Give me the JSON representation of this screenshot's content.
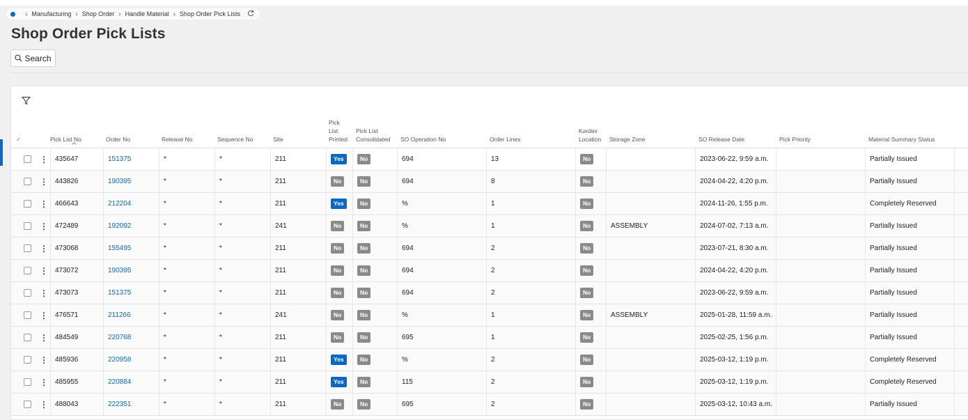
{
  "breadcrumb": {
    "items": [
      "Manufacturing",
      "Shop Order",
      "Handle Material",
      "Shop Order Pick Lists"
    ]
  },
  "page": {
    "title": "Shop Order Pick Lists",
    "search_label": "Search"
  },
  "table": {
    "columns": {
      "pick_list_no": "Pick List No",
      "order_no": "Order No",
      "release_no": "Release No",
      "sequence_no": "Sequence No",
      "site": "Site",
      "pick_list_printed_1": "Pick",
      "pick_list_printed_2": "List",
      "pick_list_printed_3": "Printed",
      "pick_list_consolidated_1": "Pick List",
      "pick_list_consolidated_2": "Consolidated",
      "so_operation_no": "SO Operation No",
      "order_lines": "Order Lines",
      "kardex_location_1": "Kardex",
      "kardex_location_2": "Location",
      "storage_zone": "Storage Zone",
      "so_release_date": "SO Release Date",
      "pick_priority": "Pick Priority",
      "material_summary_status": "Material Summary Status"
    },
    "rows": [
      {
        "pick_list_no": "435647",
        "order_no": "151375",
        "release_no": "*",
        "sequence_no": "*",
        "site": "211",
        "printed": "Yes",
        "consolidated": "No",
        "so_operation_no": "694",
        "order_lines": "13",
        "kardex": "No",
        "storage_zone": "",
        "so_release_date": "2023-06-22, 9:59 a.m.",
        "pick_priority": "",
        "status": "Partially Issued"
      },
      {
        "pick_list_no": "443826",
        "order_no": "190395",
        "release_no": "*",
        "sequence_no": "*",
        "site": "211",
        "printed": "No",
        "consolidated": "No",
        "so_operation_no": "694",
        "order_lines": "8",
        "kardex": "No",
        "storage_zone": "",
        "so_release_date": "2024-04-22, 4:20 p.m.",
        "pick_priority": "",
        "status": "Partially Issued"
      },
      {
        "pick_list_no": "466643",
        "order_no": "212204",
        "release_no": "*",
        "sequence_no": "*",
        "site": "211",
        "printed": "Yes",
        "consolidated": "No",
        "so_operation_no": "%",
        "order_lines": "1",
        "kardex": "No",
        "storage_zone": "",
        "so_release_date": "2024-11-26, 1:55 p.m.",
        "pick_priority": "",
        "status": "Completely Reserved"
      },
      {
        "pick_list_no": "472489",
        "order_no": "192092",
        "release_no": "*",
        "sequence_no": "*",
        "site": "241",
        "printed": "No",
        "consolidated": "No",
        "so_operation_no": "%",
        "order_lines": "1",
        "kardex": "No",
        "storage_zone": "ASSEMBLY",
        "so_release_date": "2024-07-02, 7:13 a.m.",
        "pick_priority": "",
        "status": "Partially Issued"
      },
      {
        "pick_list_no": "473068",
        "order_no": "155495",
        "release_no": "*",
        "sequence_no": "*",
        "site": "211",
        "printed": "No",
        "consolidated": "No",
        "so_operation_no": "694",
        "order_lines": "2",
        "kardex": "No",
        "storage_zone": "",
        "so_release_date": "2023-07-21, 8:30 a.m.",
        "pick_priority": "",
        "status": "Partially Issued"
      },
      {
        "pick_list_no": "473072",
        "order_no": "190395",
        "release_no": "*",
        "sequence_no": "*",
        "site": "211",
        "printed": "No",
        "consolidated": "No",
        "so_operation_no": "694",
        "order_lines": "2",
        "kardex": "No",
        "storage_zone": "",
        "so_release_date": "2024-04-22, 4:20 p.m.",
        "pick_priority": "",
        "status": "Partially Issued"
      },
      {
        "pick_list_no": "473073",
        "order_no": "151375",
        "release_no": "*",
        "sequence_no": "*",
        "site": "211",
        "printed": "No",
        "consolidated": "No",
        "so_operation_no": "694",
        "order_lines": "2",
        "kardex": "No",
        "storage_zone": "",
        "so_release_date": "2023-06-22, 9:59 a.m.",
        "pick_priority": "",
        "status": "Partially Issued"
      },
      {
        "pick_list_no": "476571",
        "order_no": "211266",
        "release_no": "*",
        "sequence_no": "*",
        "site": "241",
        "printed": "No",
        "consolidated": "No",
        "so_operation_no": "%",
        "order_lines": "1",
        "kardex": "No",
        "storage_zone": "ASSEMBLY",
        "so_release_date": "2025-01-28, 11:59 a.m.",
        "pick_priority": "",
        "status": "Partially Issued"
      },
      {
        "pick_list_no": "484549",
        "order_no": "220768",
        "release_no": "*",
        "sequence_no": "*",
        "site": "211",
        "printed": "No",
        "consolidated": "No",
        "so_operation_no": "695",
        "order_lines": "1",
        "kardex": "No",
        "storage_zone": "",
        "so_release_date": "2025-02-25, 1:56 p.m.",
        "pick_priority": "",
        "status": "Partially Issued"
      },
      {
        "pick_list_no": "485936",
        "order_no": "220958",
        "release_no": "*",
        "sequence_no": "*",
        "site": "211",
        "printed": "Yes",
        "consolidated": "No",
        "so_operation_no": "%",
        "order_lines": "2",
        "kardex": "No",
        "storage_zone": "",
        "so_release_date": "2025-03-12, 1:19 p.m.",
        "pick_priority": "",
        "status": "Completely Reserved"
      },
      {
        "pick_list_no": "485955",
        "order_no": "220884",
        "release_no": "*",
        "sequence_no": "*",
        "site": "211",
        "printed": "Yes",
        "consolidated": "No",
        "so_operation_no": "115",
        "order_lines": "2",
        "kardex": "No",
        "storage_zone": "",
        "so_release_date": "2025-03-12, 1:19 p.m.",
        "pick_priority": "",
        "status": "Completely Reserved"
      },
      {
        "pick_list_no": "488043",
        "order_no": "222351",
        "release_no": "*",
        "sequence_no": "*",
        "site": "211",
        "printed": "No",
        "consolidated": "No",
        "so_operation_no": "695",
        "order_lines": "2",
        "kardex": "No",
        "storage_zone": "",
        "so_release_date": "2025-03-12, 10:43 a.m.",
        "pick_priority": "",
        "status": "Partially Issued"
      }
    ]
  },
  "colors": {
    "accent": "#0b68c4",
    "badge_no": "#8a8a8a",
    "badge_yes": "#0b68c4"
  },
  "icons": {
    "breadcrumb_home": "navigator-dot-icon",
    "separator": "chevron-right-icon",
    "refresh": "refresh-icon",
    "search": "search-icon",
    "filter": "filter-icon",
    "row_menu": "kebab-menu-icon",
    "select_all": "check-icon",
    "sort": "sort-ascending-icon"
  }
}
